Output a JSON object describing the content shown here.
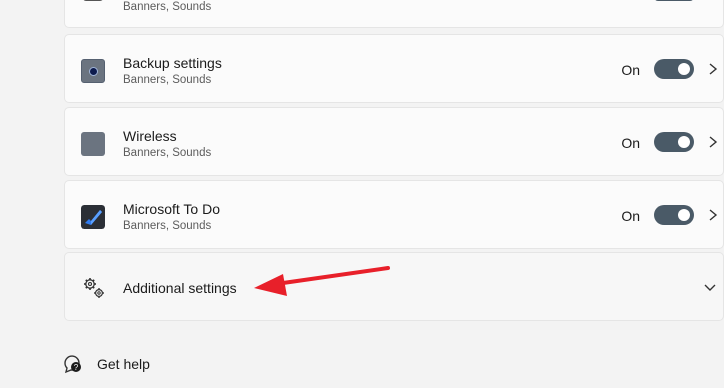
{
  "apps": [
    {
      "title": "",
      "subtitle": "Banners, Sounds",
      "icon": "app-icon-partial"
    },
    {
      "title": "Backup settings",
      "subtitle": "Banners, Sounds",
      "state": "On",
      "icon": "backup-icon",
      "toggle_on": true
    },
    {
      "title": "Wireless",
      "subtitle": "Banners, Sounds",
      "state": "On",
      "icon": "wireless-icon",
      "toggle_on": true
    },
    {
      "title": "Microsoft To Do",
      "subtitle": "Banners, Sounds",
      "state": "On",
      "icon": "todo-check-icon",
      "toggle_on": true
    }
  ],
  "additional": {
    "label": "Additional settings",
    "icon": "gears-icon"
  },
  "help": {
    "label": "Get help",
    "icon": "help-chat-icon"
  },
  "colors": {
    "toggle_track": "#4a5a67",
    "annotation_arrow": "#e8202a",
    "todo_blue": "#2f7bf0"
  }
}
